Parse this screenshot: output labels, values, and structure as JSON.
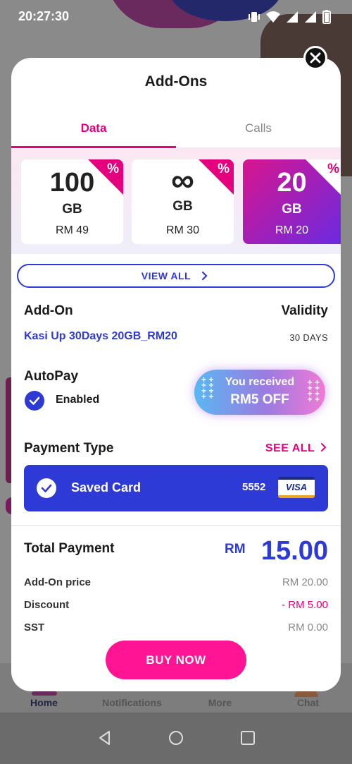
{
  "status_bar": {
    "time": "20:27:30"
  },
  "background": {
    "bottom_nav": [
      "Home",
      "Notifications",
      "More",
      "Chat"
    ]
  },
  "modal": {
    "title": "Add-Ons",
    "tabs": [
      {
        "label": "Data",
        "active": true
      },
      {
        "label": "Calls",
        "active": false
      }
    ],
    "plans": [
      {
        "amount": "100",
        "unit": "GB",
        "price": "RM 49",
        "promo": "%",
        "selected": false
      },
      {
        "amount": "∞",
        "unit": "GB",
        "price": "RM 30",
        "promo": "%",
        "selected": false
      },
      {
        "amount": "20",
        "unit": "GB",
        "price": "RM 20",
        "promo": "%",
        "selected": true
      }
    ],
    "view_all_label": "VIEW ALL",
    "addon": {
      "label": "Add-On",
      "validity_label": "Validity",
      "name": "Kasi Up 30Days 20GB_RM20",
      "validity": "30 DAYS"
    },
    "autopay": {
      "label": "AutoPay",
      "status": "Enabled"
    },
    "promo": {
      "line1": "You received",
      "line2": "RM5 OFF"
    },
    "payment": {
      "label": "Payment Type",
      "see_all_label": "SEE ALL",
      "card_label": "Saved Card",
      "card_last4": "5552",
      "card_brand": "VISA"
    },
    "total": {
      "label": "Total Payment",
      "currency": "RM",
      "amount": "15.00",
      "lines": [
        {
          "label": "Add-On price",
          "value": "RM 20.00"
        },
        {
          "label": "Discount",
          "value": "- RM 5.00"
        },
        {
          "label": "SST",
          "value": "RM 0.00"
        }
      ]
    },
    "buy_label": "BUY NOW"
  },
  "colors": {
    "accent_pink": "#e5007e",
    "accent_blue": "#2e3ad6",
    "buy_button": "#ff1493"
  }
}
